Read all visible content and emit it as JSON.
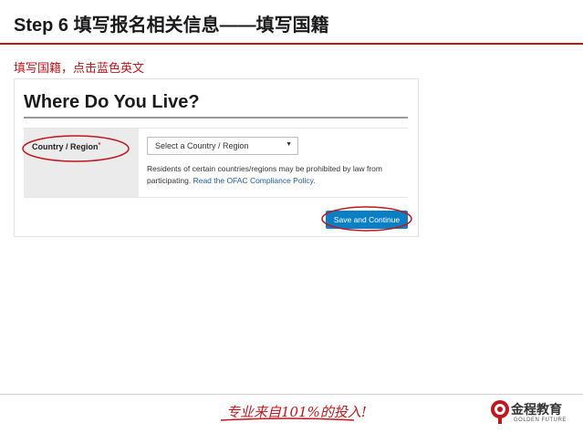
{
  "slide": {
    "title": "Step 6 填写报名相关信息——填写国籍",
    "instruction": "填写国籍，点击蓝色英文"
  },
  "form": {
    "heading": "Where Do You Live?",
    "field_label": "Country / Region",
    "required_mark": "*",
    "select_value": "Select a Country / Region",
    "help_text": "Residents of certain countries/regions may be prohibited by law from participating.",
    "help_link": "Read the OFAC Compliance Policy.",
    "save_label": "Save and Continue"
  },
  "footer": {
    "slogan": "专业来自101%的投入!",
    "brand_name": "金程教育",
    "brand_sub": "GOLDEN FUTURE"
  },
  "colors": {
    "accent_red": "#c0161c",
    "button_blue": "#0a7fc4",
    "link_blue": "#1f5aa0"
  }
}
